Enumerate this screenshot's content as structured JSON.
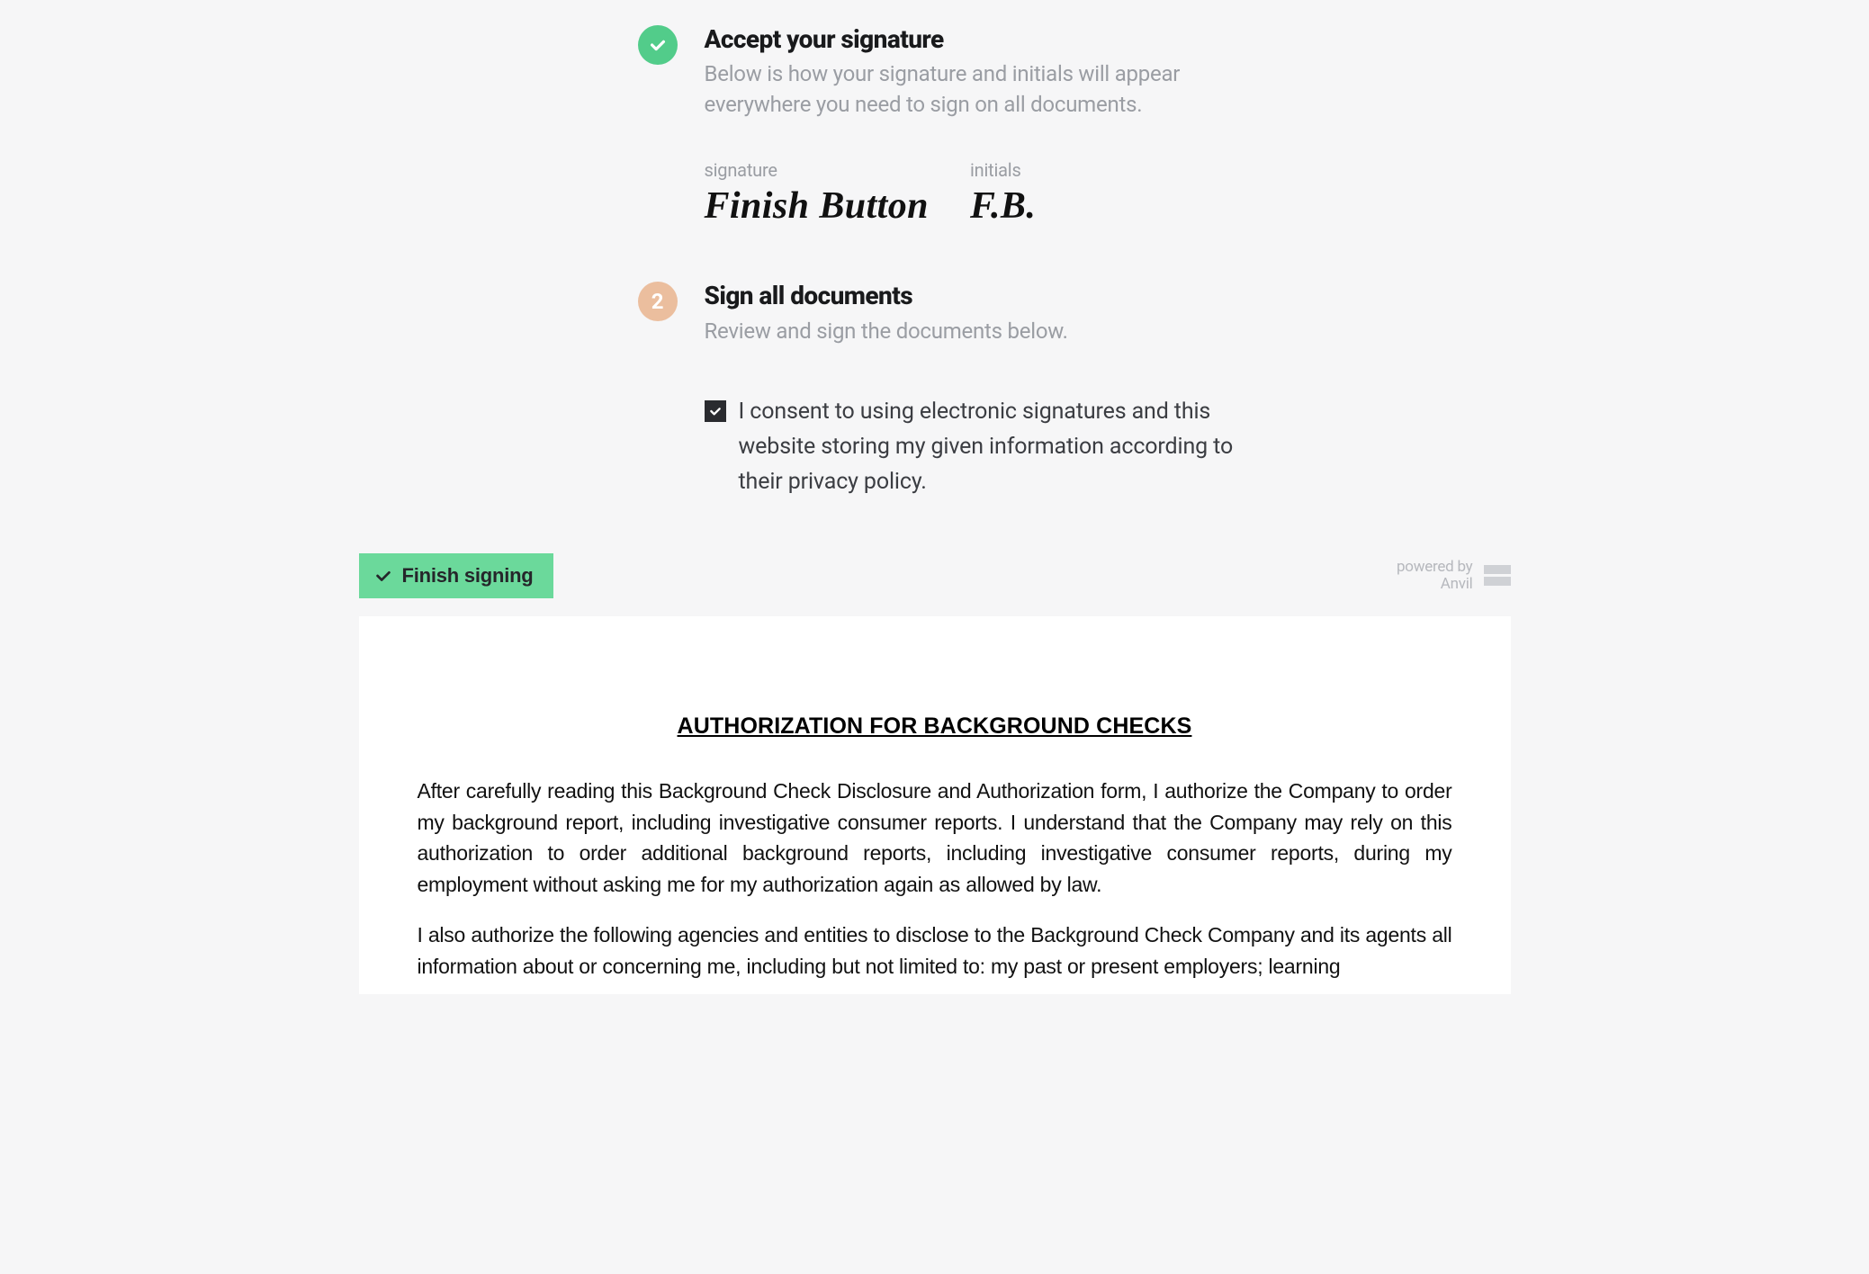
{
  "steps": {
    "accept": {
      "title": "Accept your signature",
      "subtitle": "Below is how your signature and initials will appear everywhere you need to sign on all documents.",
      "signature_label": "signature",
      "signature_value": "Finish Button",
      "initials_label": "initials",
      "initials_value": "F.B."
    },
    "sign": {
      "number": "2",
      "title": "Sign all documents",
      "subtitle": "Review and sign the documents below.",
      "consent_text": "I consent to using electronic signatures and this website storing my given information according to their privacy policy.",
      "consent_checked": true
    }
  },
  "toolbar": {
    "finish_label": "Finish signing",
    "powered_line1": "powered by",
    "powered_line2": "Anvil"
  },
  "document": {
    "title": "AUTHORIZATION FOR BACKGROUND CHECKS",
    "paragraph1": "After carefully reading this Background Check Disclosure and Authorization form, I authorize the Company to order my background report, including investigative consumer reports.  I understand that the Company may rely on this authorization to order additional background reports, including investigative consumer reports, during my employment without asking me for my authorization again as allowed by law.",
    "paragraph2": "I also authorize the following agencies and entities to disclose to the Background Check Company and its agents all information about or concerning me, including but not limited to: my past or present employers; learning"
  }
}
